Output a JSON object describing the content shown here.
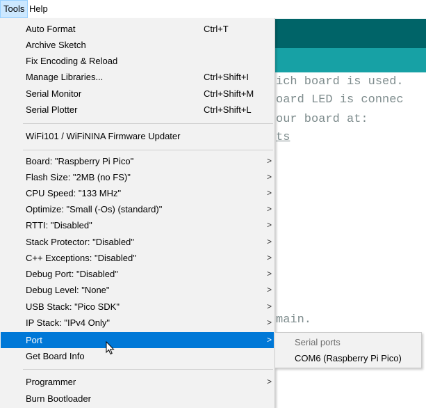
{
  "menubar": {
    "tools": "Tools",
    "help": "Help"
  },
  "editor": {
    "lines": [
      "ich board is used.",
      "oard LED is connec",
      "our board at:",
      "ts"
    ],
    "main_text": "main."
  },
  "tools_menu": {
    "items": [
      {
        "label": "Auto Format",
        "shortcut": "Ctrl+T"
      },
      {
        "label": "Archive Sketch",
        "shortcut": ""
      },
      {
        "label": "Fix Encoding & Reload",
        "shortcut": ""
      },
      {
        "label": "Manage Libraries...",
        "shortcut": "Ctrl+Shift+I"
      },
      {
        "label": "Serial Monitor",
        "shortcut": "Ctrl+Shift+M"
      },
      {
        "label": "Serial Plotter",
        "shortcut": "Ctrl+Shift+L"
      },
      {
        "label": "WiFi101 / WiFiNINA Firmware Updater",
        "shortcut": ""
      },
      {
        "label": "Board: \"Raspberry Pi Pico\"",
        "submenu": true
      },
      {
        "label": "Flash Size: \"2MB (no FS)\"",
        "submenu": true
      },
      {
        "label": "CPU Speed: \"133 MHz\"",
        "submenu": true
      },
      {
        "label": "Optimize: \"Small (-Os) (standard)\"",
        "submenu": true
      },
      {
        "label": "RTTI: \"Disabled\"",
        "submenu": true
      },
      {
        "label": "Stack Protector: \"Disabled\"",
        "submenu": true
      },
      {
        "label": "C++ Exceptions: \"Disabled\"",
        "submenu": true
      },
      {
        "label": "Debug Port: \"Disabled\"",
        "submenu": true
      },
      {
        "label": "Debug Level: \"None\"",
        "submenu": true
      },
      {
        "label": "USB Stack: \"Pico SDK\"",
        "submenu": true
      },
      {
        "label": "IP Stack: \"IPv4 Only\"",
        "submenu": true
      },
      {
        "label": "Port",
        "submenu": true,
        "highlighted": true
      },
      {
        "label": "Get Board Info",
        "shortcut": ""
      },
      {
        "label": "Programmer",
        "submenu": true
      },
      {
        "label": "Burn Bootloader",
        "shortcut": ""
      }
    ],
    "arrow_glyph": ">"
  },
  "port_submenu": {
    "header": "Serial ports",
    "items": [
      "COM6 (Raspberry Pi Pico)"
    ]
  },
  "colors": {
    "highlight": "#0078d7",
    "editor_header": "#006468",
    "editor_toolbar": "#17a1a5"
  },
  "icons": {
    "cursor": "mouse-pointer-icon"
  }
}
